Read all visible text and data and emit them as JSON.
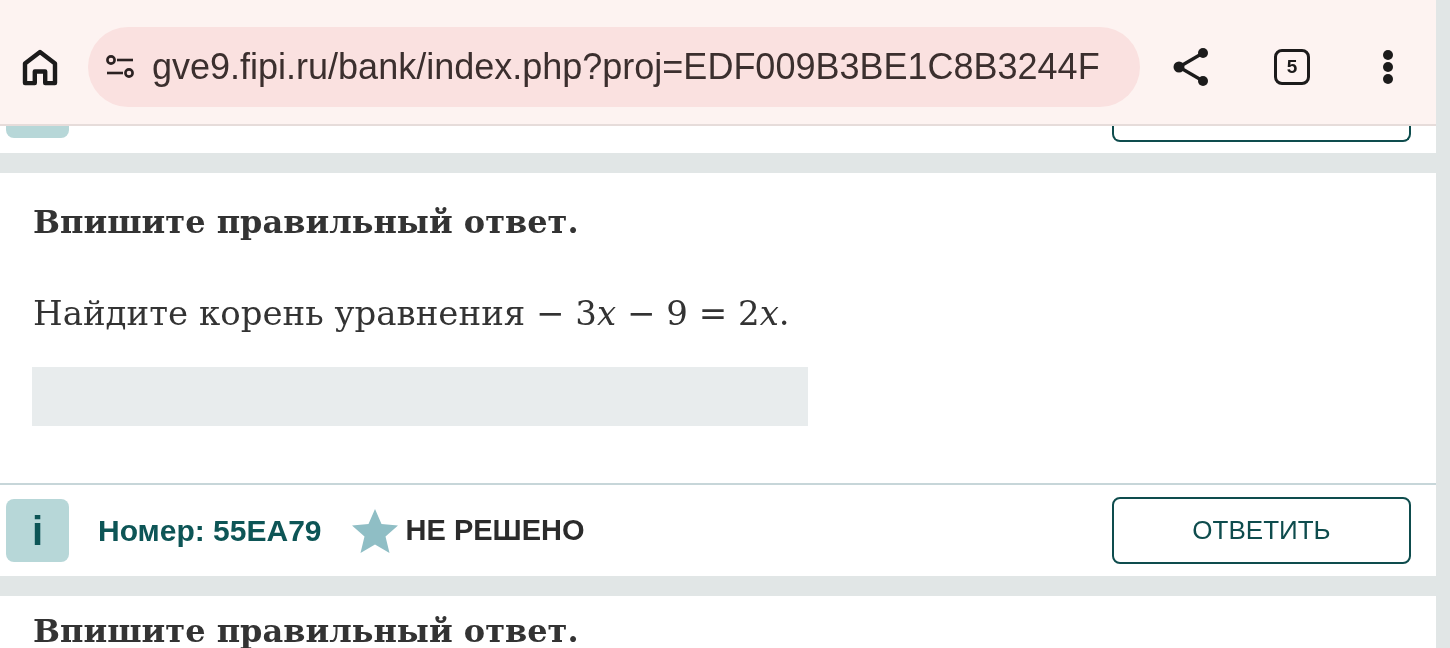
{
  "browser": {
    "url": "gve9.fipi.ru/bank/index.php?proj=EDF009B3BE1C8B3244F",
    "tab_count": "5"
  },
  "tasks": [
    {
      "instruction": "Впишите правильный ответ.",
      "question": {
        "text": "Найдите корень уравнения",
        "equation": [
          {
            "kind": "text",
            "text": "− 3"
          },
          {
            "kind": "var",
            "text": "x"
          },
          {
            "kind": "text",
            "text": "− 9 = 2"
          },
          {
            "kind": "var",
            "text": "x"
          },
          {
            "kind": "punct",
            "text": "."
          }
        ]
      },
      "info_label": "i",
      "number": "Номер: 55EA79",
      "status": "НЕ РЕШЕНО",
      "button": "ОТВЕТИТЬ"
    },
    {
      "instruction": "Впишите правильный ответ."
    }
  ]
}
